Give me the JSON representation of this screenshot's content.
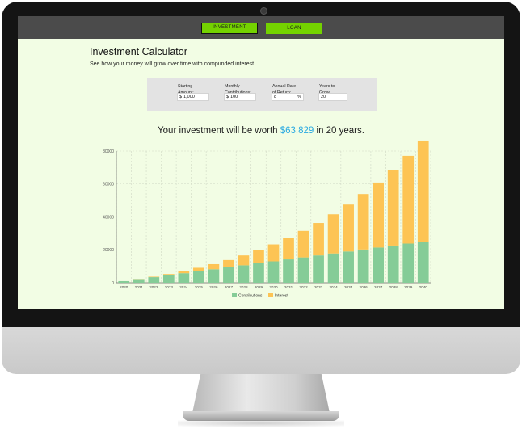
{
  "nav": {
    "tabs": [
      {
        "label": "INVESTMENT",
        "active": true
      },
      {
        "label": "LOAN",
        "active": false
      }
    ]
  },
  "header": {
    "title": "Investment Calculator",
    "subtitle": "See how your money will grow over time with compunded interest."
  },
  "inputs": {
    "starting_amount": {
      "label": "Starting\nAmount:",
      "prefix": "$",
      "value": "1,000"
    },
    "monthly_contributions": {
      "label": "Monthly\nContributions:",
      "prefix": "$",
      "value": "100"
    },
    "annual_rate": {
      "label": "Annual Rate\nof Return:",
      "value": "8",
      "suffix": "%"
    },
    "years": {
      "label": "Years to\nGrow:",
      "value": "20"
    }
  },
  "result": {
    "prefix": "Your investment will be worth ",
    "amount": "$63,829",
    "suffix": " in 20 years."
  },
  "colors": {
    "accent_green": "#74d200",
    "contributions": "#85cc97",
    "interest": "#fdc454",
    "result_amount": "#29a9e1",
    "screen_bg": "#f2fde4"
  },
  "chart_data": {
    "type": "bar",
    "stacked": true,
    "categories": [
      "2020",
      "2021",
      "2022",
      "2023",
      "2024",
      "2025",
      "2026",
      "2027",
      "2028",
      "2029",
      "2030",
      "2031",
      "2032",
      "2033",
      "2034",
      "2035",
      "2036",
      "2037",
      "2038",
      "2039",
      "2040"
    ],
    "series": [
      {
        "name": "Contributions",
        "color": "#85cc97",
        "values": [
          1000,
          2200,
          3400,
          4600,
          5800,
          7000,
          8200,
          9400,
          10600,
          11800,
          13000,
          14200,
          15400,
          16600,
          17800,
          19000,
          20200,
          21400,
          22600,
          23800,
          25000
        ]
      },
      {
        "name": "Interest",
        "color": "#fdc454",
        "values": [
          0,
          80,
          300,
          700,
          1300,
          2100,
          3100,
          4400,
          6000,
          8000,
          10300,
          13000,
          16100,
          19700,
          23800,
          28500,
          33700,
          39500,
          46100,
          53300,
          61400
        ]
      }
    ],
    "ylim": [
      0,
      80000
    ],
    "yticks": [
      "0",
      "20000",
      "40000",
      "60000",
      "80000"
    ],
    "grid": true,
    "legend": "bottom"
  }
}
